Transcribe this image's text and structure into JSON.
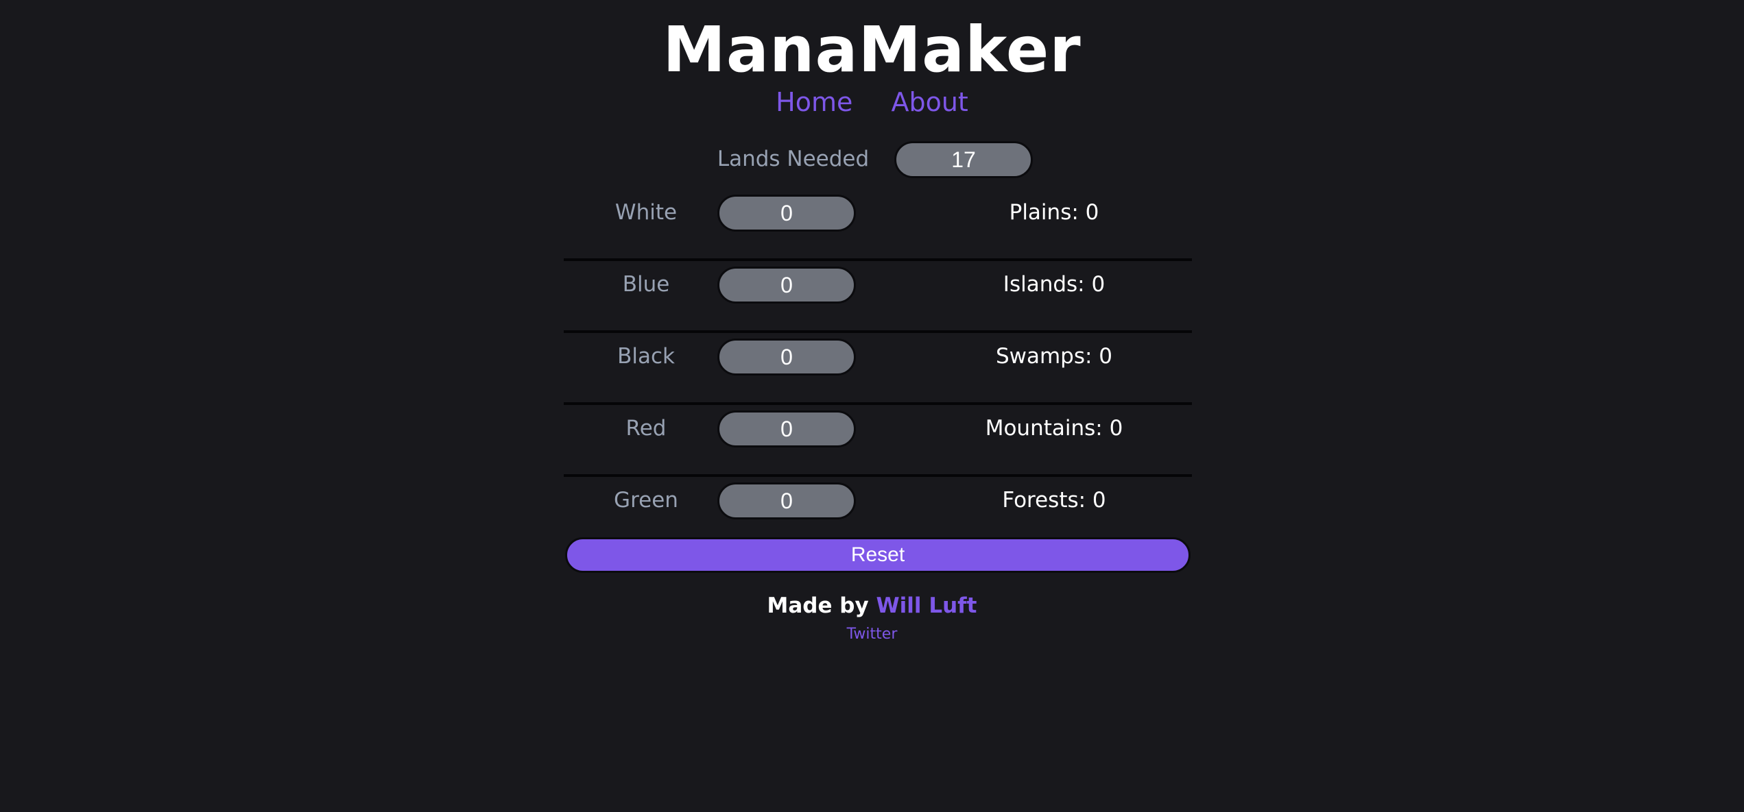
{
  "app": {
    "title": "ManaMaker"
  },
  "nav": {
    "home": "Home",
    "about": "About"
  },
  "lands_needed": {
    "label": "Lands Needed",
    "value": "17"
  },
  "colors": [
    {
      "name": "White",
      "value": "0",
      "land_result": "Plains: 0"
    },
    {
      "name": "Blue",
      "value": "0",
      "land_result": "Islands: 0"
    },
    {
      "name": "Black",
      "value": "0",
      "land_result": "Swamps: 0"
    },
    {
      "name": "Red",
      "value": "0",
      "land_result": "Mountains: 0"
    },
    {
      "name": "Green",
      "value": "0",
      "land_result": "Forests: 0"
    }
  ],
  "reset": {
    "label": "Reset"
  },
  "footer": {
    "made_by": "Made by",
    "author": "Will Luft",
    "twitter": "Twitter"
  },
  "theme": {
    "background": "#18181c",
    "accent": "#7e57e8",
    "input_fill": "#6e727b",
    "label_color": "#98a2b3"
  }
}
